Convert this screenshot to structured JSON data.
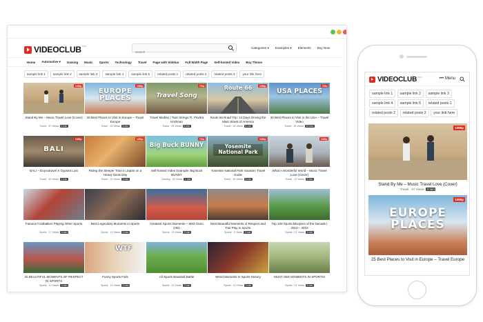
{
  "brand": {
    "logo_text": "VIDEOCLUB",
    "logo_sup": "PRO",
    "accent_color": "#e02b20"
  },
  "header": {
    "search_placeholder": "Search",
    "right_nav": [
      "Categories",
      "Examples",
      "Elements",
      "Buy Now"
    ]
  },
  "main_nav": [
    "Home",
    "Automotive",
    "Gaming",
    "Music",
    "Sports",
    "Technology",
    "Travel",
    "Page with Sidebar",
    "Full Width Page",
    "Self-hosted Video",
    "Buy Theme"
  ],
  "tags": [
    "sample link 1",
    "sample link 2",
    "sample link 3",
    "sample link 4",
    "sample link 5",
    "related posts 1",
    "related posts 2",
    "related posts 3",
    "your link here"
  ],
  "videos": [
    {
      "title": "Stand By Me – Music Travel Love (Cover)",
      "category": "Travel",
      "views": "97 Views",
      "duration": "3 min",
      "badge": "1080p",
      "thumb_text": ""
    },
    {
      "title": "25 Best Places to Visit in Europe – Travel Europe",
      "category": "Travel",
      "views": "25 Views",
      "duration": "3 min",
      "badge": "1080p",
      "thumb_text": "EUROPE PLACES"
    },
    {
      "title": "Travel Medley | Twin Strings Ft. Pavitra Krishnan",
      "category": "Travel",
      "views": "25 Views",
      "duration": "6 min",
      "badge": "720p",
      "thumb_text": "Travel Song"
    },
    {
      "title": "Route 66 Road Trip: 14 Days Driving the Main Street of America",
      "category": "Travel",
      "views": "25 Views",
      "duration": "6 min",
      "badge": "1080p",
      "thumb_text": "Route 66"
    },
    {
      "title": "25 Best Places to Visit in the USA – Travel Video",
      "category": "Travel",
      "views": "25 Views",
      "duration": "12 min",
      "badge": "720p",
      "thumb_text": "USA PLACES"
    },
    {
      "title": "BALI – Doyoutravel X Gypsea Lust",
      "category": "Travel",
      "views": "25 Views",
      "duration": "3 min",
      "badge": "1080p",
      "thumb_text": "BALI"
    },
    {
      "title": "Riding the Sleeper Train in Japan on a Heavy Snow Day",
      "category": "Travel",
      "views": "25 Views",
      "duration": "3 min",
      "badge": "1080p",
      "thumb_text": ""
    },
    {
      "title": "Self-hosted Video Example: Big Buck BUNNY",
      "category": "Gaming",
      "views": "55 Views",
      "duration": "1 min",
      "badge": "720p",
      "thumb_text": "Big Buck BUNNY"
    },
    {
      "title": "Yosemite National Park Vacation Travel Guide",
      "category": "Travel",
      "views": "16 Views",
      "duration": "3 min",
      "badge": "1080p",
      "thumb_text": "Yosemite National Park"
    },
    {
      "title": "What A Wonderful World – Music Travel Love (Cover)",
      "category": "Travel",
      "views": "12 Views",
      "duration": "3 min",
      "badge": "1080p",
      "thumb_text": ""
    },
    {
      "title": "Famous Footballers Playing Other Sports",
      "category": "Sports",
      "views": "17 Views",
      "duration": "3 min",
      "badge": "",
      "thumb_text": ""
    },
    {
      "title": "Best Legendary Moments in Sports",
      "category": "Sports",
      "views": "11 Views",
      "duration": "3 min",
      "badge": "",
      "thumb_text": ""
    },
    {
      "title": "Greatest Sports Moments – M83 Outro (HD)",
      "category": "Sports",
      "views": "10 Views",
      "duration": "3 min",
      "badge": "",
      "thumb_text": ""
    },
    {
      "title": "Most Beautiful Moments of Respect and Fair Play in Sports",
      "category": "Sports",
      "views": "9 Views",
      "duration": "3 min",
      "badge": "",
      "thumb_text": ""
    },
    {
      "title": "Top 100 Sports Bloopers of the Decade | 2010 – 2019",
      "category": "Sports",
      "views": "11 Views",
      "duration": "3 min",
      "badge": "",
      "thumb_text": ""
    },
    {
      "title": "20 BEAUTIFUL MOMENTS OF RESPECT IN SPORTS",
      "category": "Sports",
      "views": "12 Views",
      "duration": "3 min",
      "badge": "",
      "thumb_text": ""
    },
    {
      "title": "Funny Sports Fails",
      "category": "Sports",
      "views": "12 Views",
      "duration": "3 min",
      "badge": "",
      "thumb_text": "WTF"
    },
    {
      "title": "All Sports Baseball Battle",
      "category": "Sports",
      "views": "10 Views",
      "duration": "3 min",
      "badge": "",
      "thumb_text": ""
    },
    {
      "title": "Weird Moments in Sports History",
      "category": "Sports",
      "views": "11 Views",
      "duration": "3 min",
      "badge": "",
      "thumb_text": ""
    },
    {
      "title": "MUST SEE MOMENTS IN SPORTS!",
      "category": "Sports",
      "views": "11 Views",
      "duration": "3 min",
      "badge": "",
      "thumb_text": ""
    }
  ],
  "mobile": {
    "menu_label": "Menu",
    "tags": [
      "sample link 1",
      "sample link 2",
      "sample link 3",
      "sample link 4",
      "sample link 5",
      "related posts 1",
      "related posts 2",
      "related posts 3",
      "your link here"
    ],
    "videos": [
      {
        "title": "Stand By Me – Music Travel Love (Cover)",
        "category": "Travel",
        "views": "97 Views",
        "duration": "3 min",
        "badge": "1080p"
      },
      {
        "title": "25 Best Places to Visit in Europe – Travel Europe",
        "category": "Travel",
        "views": "",
        "duration": "",
        "badge": "1080p",
        "thumb_text": "EUROPE PLACES"
      }
    ]
  }
}
